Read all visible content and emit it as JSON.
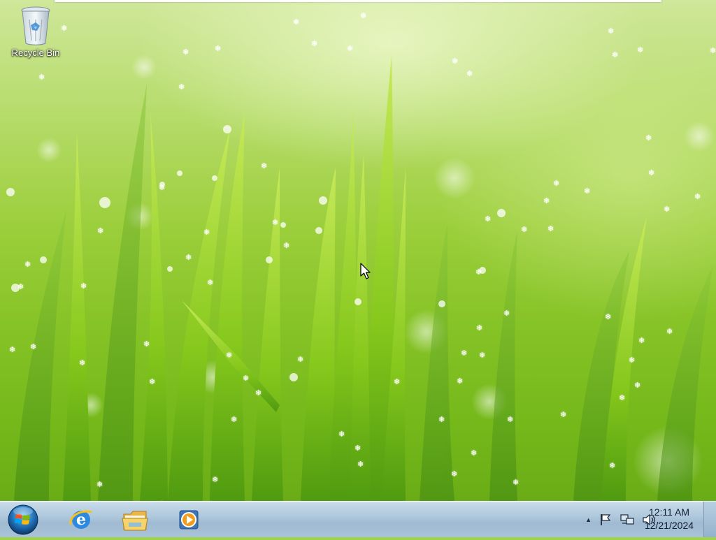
{
  "desktop": {
    "icons": [
      {
        "label": "Recycle Bin",
        "icon": "recycle-bin-icon"
      }
    ],
    "wallpaper": "green grass with water droplets"
  },
  "taskbar": {
    "start_button": {
      "icon": "windows-start-orb-icon"
    },
    "pinned": [
      {
        "name": "internet-explorer",
        "icon": "internet-explorer-icon"
      },
      {
        "name": "windows-explorer",
        "icon": "folder-icon"
      },
      {
        "name": "media-player",
        "icon": "media-player-icon"
      }
    ],
    "tray": {
      "show_hidden_icon": "▲",
      "icons": [
        "action-center-flag-icon",
        "network-icon",
        "volume-icon"
      ]
    },
    "clock": {
      "time": "12:11 AM",
      "date": "12/21/2024"
    }
  },
  "colors": {
    "taskbar_top": "#c8dbe9",
    "taskbar_bottom": "#9fbad2",
    "grass_light": "#cfe79a",
    "grass_dark": "#6aac16"
  }
}
